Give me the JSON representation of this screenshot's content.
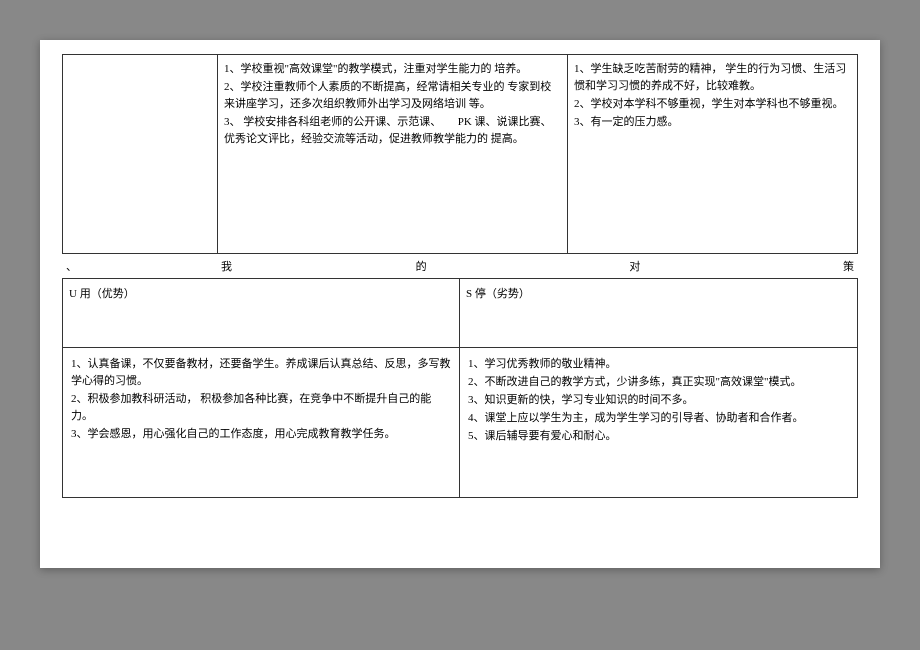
{
  "top": {
    "col1": "",
    "col2": [
      "1、学校重视\"高效课堂\"的教学模式，注重对学生能力的 培养。",
      "2、学校注重教师个人素质的不断提高，经常请相关专业的 专家到校来讲座学习，还多次组织教师外出学习及网络培训 等。",
      "3、 学校安排各科组老师的公开课、示范课、　　PK 课、说课比赛、优秀论文评比，经验交流等活动，促进教师教学能力的 提高。"
    ],
    "col3": [
      "1、学生缺乏吃苦耐劳的精神， 学生的行为习惯、生活习惯和学习习惯的养成不好，比较难教。",
      "2、学校对本学科不够重视，学生对本学科也不够重视。",
      "3、有一定的压力感。"
    ]
  },
  "title_line": {
    "a": "、",
    "b": "我",
    "c": "的",
    "d": "对",
    "e": "策"
  },
  "headers": {
    "left": "U 用（优势）",
    "right": "S 停（劣势）"
  },
  "bottom": {
    "left": [
      "1、认真备课，不仅要备教材，还要备学生。养成课后认真总结、反思，多写教学心得的习惯。",
      "2、积极参加教科研活动， 积极参加各种比赛，在竞争中不断提升自己的能力。",
      "3、学会感恩，用心强化自己的工作态度，用心完成教育教学任务。"
    ],
    "right": [
      "1、学习优秀教师的敬业精神。",
      "2、不断改进自己的教学方式，少讲多练，真正实现\"高效课堂\"模式。",
      "3、知识更新的快，学习专业知识的时间不多。",
      "4、课堂上应以学生为主，成为学生学习的引导者、协助者和合作者。",
      "5、课后辅导要有爱心和耐心。"
    ]
  }
}
